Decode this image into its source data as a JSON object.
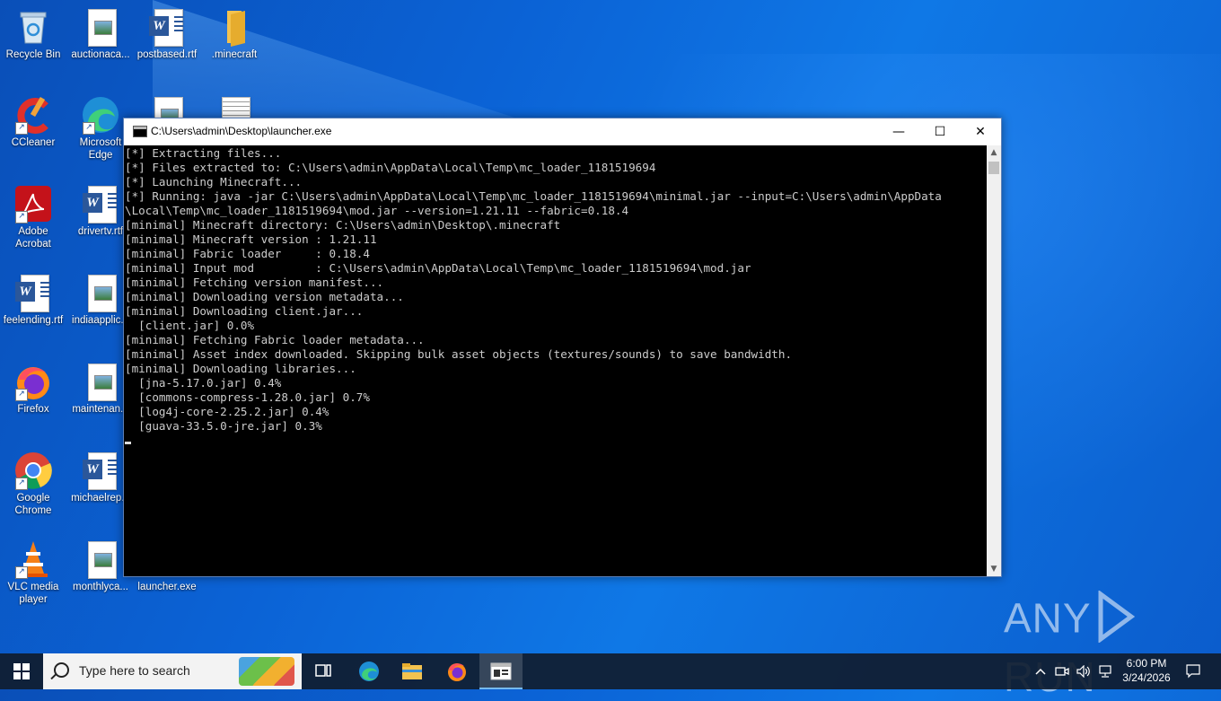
{
  "desktop": {
    "icons": [
      {
        "label": "Recycle Bin"
      },
      {
        "label": "auctionaca..."
      },
      {
        "label": "postbased.rtf"
      },
      {
        "label": ".minecraft"
      },
      {
        "label": "CCleaner"
      },
      {
        "label": "Microsoft Edge"
      },
      {
        "label": "Adobe Acrobat"
      },
      {
        "label": "drivertv.rtf"
      },
      {
        "label": "feelending.rtf"
      },
      {
        "label": "indiaapplic..."
      },
      {
        "label": "Firefox"
      },
      {
        "label": "maintenan..."
      },
      {
        "label": "Google Chrome"
      },
      {
        "label": "michaelrep..."
      },
      {
        "label": "VLC media player"
      },
      {
        "label": "monthlyca..."
      },
      {
        "label": "launcher.exe"
      }
    ]
  },
  "window": {
    "title": "C:\\Users\\admin\\Desktop\\launcher.exe",
    "minimize": "—",
    "maximize": "☐",
    "close": "✕"
  },
  "console": {
    "lines": [
      "[*] Extracting files...",
      "[*] Files extracted to: C:\\Users\\admin\\AppData\\Local\\Temp\\mc_loader_1181519694",
      "[*] Launching Minecraft...",
      "[*] Running: java -jar C:\\Users\\admin\\AppData\\Local\\Temp\\mc_loader_1181519694\\minimal.jar --input=C:\\Users\\admin\\AppData",
      "\\Local\\Temp\\mc_loader_1181519694\\mod.jar --version=1.21.11 --fabric=0.18.4",
      "[minimal] Minecraft directory: C:\\Users\\admin\\Desktop\\.minecraft",
      "[minimal] Minecraft version : 1.21.11",
      "[minimal] Fabric loader     : 0.18.4",
      "[minimal] Input mod         : C:\\Users\\admin\\AppData\\Local\\Temp\\mc_loader_1181519694\\mod.jar",
      "[minimal] Fetching version manifest...",
      "[minimal] Downloading version metadata...",
      "[minimal] Downloading client.jar...",
      "  [client.jar] 0.0%",
      "[minimal] Fetching Fabric loader metadata...",
      "[minimal] Asset index downloaded. Skipping bulk asset objects (textures/sounds) to save bandwidth.",
      "[minimal] Downloading libraries...",
      "  [jna-5.17.0.jar] 0.4%",
      "  [commons-compress-1.28.0.jar] 0.7%",
      "  [log4j-core-2.25.2.jar] 0.4%",
      "  [guava-33.5.0-jre.jar] 0.3%",
      ""
    ]
  },
  "watermark": {
    "left": "ANY",
    "right": "RUN"
  },
  "taskbar": {
    "search_placeholder": "Type here to search",
    "time": "6:00 PM",
    "date": "3/24/2026"
  },
  "colors": {
    "console_text": "#cccccc",
    "desktop_blue": "#0b63d6",
    "taskbar": "#101c2e"
  }
}
